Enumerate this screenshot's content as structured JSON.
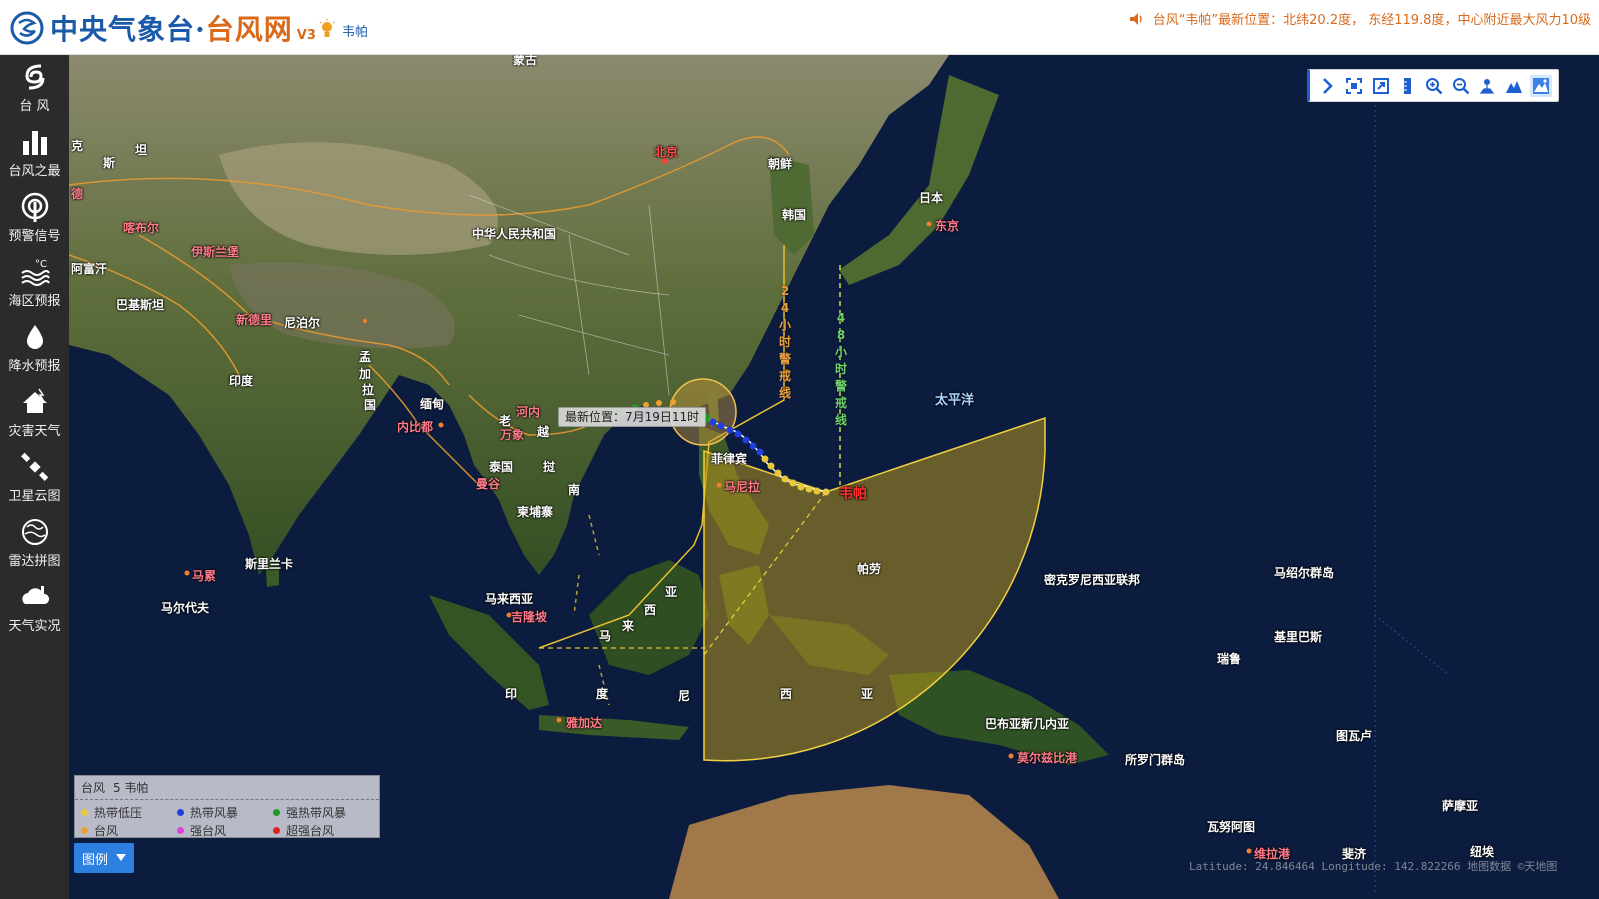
{
  "header": {
    "logo_main": "中央气象台·",
    "logo_accent": "台风网",
    "logo_version": "V3",
    "current_typhoon": "韦帕",
    "ticker": "台风“韦帕”最新位置：北纬20.2度， 东经119.8度，中心附近最大风力10级"
  },
  "sidebar": {
    "items": [
      {
        "label": "台 风",
        "icon": "typhoon-icon"
      },
      {
        "label": "台风之最",
        "icon": "bar-chart-icon"
      },
      {
        "label": "预警信号",
        "icon": "warning-signal-icon"
      },
      {
        "label": "海区预报",
        "icon": "sea-forecast-icon"
      },
      {
        "label": "降水预报",
        "icon": "rain-drop-icon"
      },
      {
        "label": "灾害天气",
        "icon": "disaster-weather-icon"
      },
      {
        "label": "卫星云图",
        "icon": "satellite-icon"
      },
      {
        "label": "雷达拼图",
        "icon": "radar-icon"
      },
      {
        "label": "天气实况",
        "icon": "weather-live-icon"
      }
    ]
  },
  "toolbar": {
    "buttons": [
      "collapse-arrow-icon",
      "fullscreen-icon",
      "exit-fullscreen-icon",
      "ruler-icon",
      "zoom-in-icon",
      "zoom-out-icon",
      "map-street-icon",
      "map-terrain-icon",
      "map-satellite-icon"
    ]
  },
  "map": {
    "tooltip": "最新位置：7月19日11时",
    "typhoon_label": "韦帕",
    "warn24": "24小时警戒线",
    "warn48": "48小时警戒线",
    "labels": {
      "menggu": "蒙古",
      "beijing": "北京",
      "chaoxian": "朝鲜",
      "hanguo": "韩国",
      "riben": "日本",
      "dongjing": "东京",
      "zhonghua": "中华人民共和国",
      "ke": "克",
      "si": "斯",
      "tan": "坦",
      "de": "德",
      "kabuer": "喀布尔",
      "afuhan": "阿富汗",
      "yisilanbao": "伊斯兰堡",
      "bajisitan": "巴基斯坦",
      "xindeli": "新德里",
      "niboer": "尼泊尔",
      "yindu": "印度",
      "meng": "孟",
      "jia": "加",
      "la": "拉",
      "guo": "国",
      "miandian": "缅甸",
      "neibidu": "内比都",
      "henei": "河内",
      "lao": "老",
      "wanxiang": "万象",
      "yue": "越",
      "taiguo": "泰国",
      "mangu": "曼谷",
      "yuenan_nan": "南",
      "yuenan_wo": "挝",
      "jianpuzhai": "柬埔寨",
      "feilvbin": "菲律宾",
      "manila": "马尼拉",
      "sililanka": "斯里兰卡",
      "male": "马累",
      "maerdaifu": "马尔代夫",
      "malaixiya": "马来西亚",
      "jilongpo": "吉隆坡",
      "ma2": "马",
      "lai2": "来",
      "xi2": "西",
      "ya2": "亚",
      "yin3": "印",
      "du3": "度",
      "ni3": "尼",
      "xi3": "西",
      "ya3": "亚",
      "yajiada": "雅加达",
      "palao": "帕劳",
      "taipingyang": "太平洋",
      "mikeluonixiya": "密克罗尼西亚联邦",
      "mashaoer": "马绍尔群岛",
      "jilibasi": "基里巴斯",
      "ruilu": "瑞鲁",
      "babuya": "巴布亚新几内亚",
      "moerzibigang": "莫尔兹比港",
      "suoluomen": "所罗门群岛",
      "tuwalu": "图瓦卢",
      "wanuatu": "瓦努阿图",
      "weilagang": "维拉港",
      "feiji": "斐济",
      "saimoya": "萨摩亚",
      "niuyue": "纽埃"
    }
  },
  "legend": {
    "title": "台风",
    "number": "5 韦帕",
    "items": [
      {
        "label": "热带低压",
        "color": "#e8c93a"
      },
      {
        "label": "热带风暴",
        "color": "#1f3fe0"
      },
      {
        "label": "强热带风暴",
        "color": "#1f9a2a"
      },
      {
        "label": "台风",
        "color": "#f0a030"
      },
      {
        "label": "强台风",
        "color": "#e040e0"
      },
      {
        "label": "超强台风",
        "color": "#e02020"
      }
    ],
    "toggle_label": "图例"
  },
  "coords_text": "Latitude: 24.846464 Longitude: 142.822266  地图数据 ©天地图"
}
